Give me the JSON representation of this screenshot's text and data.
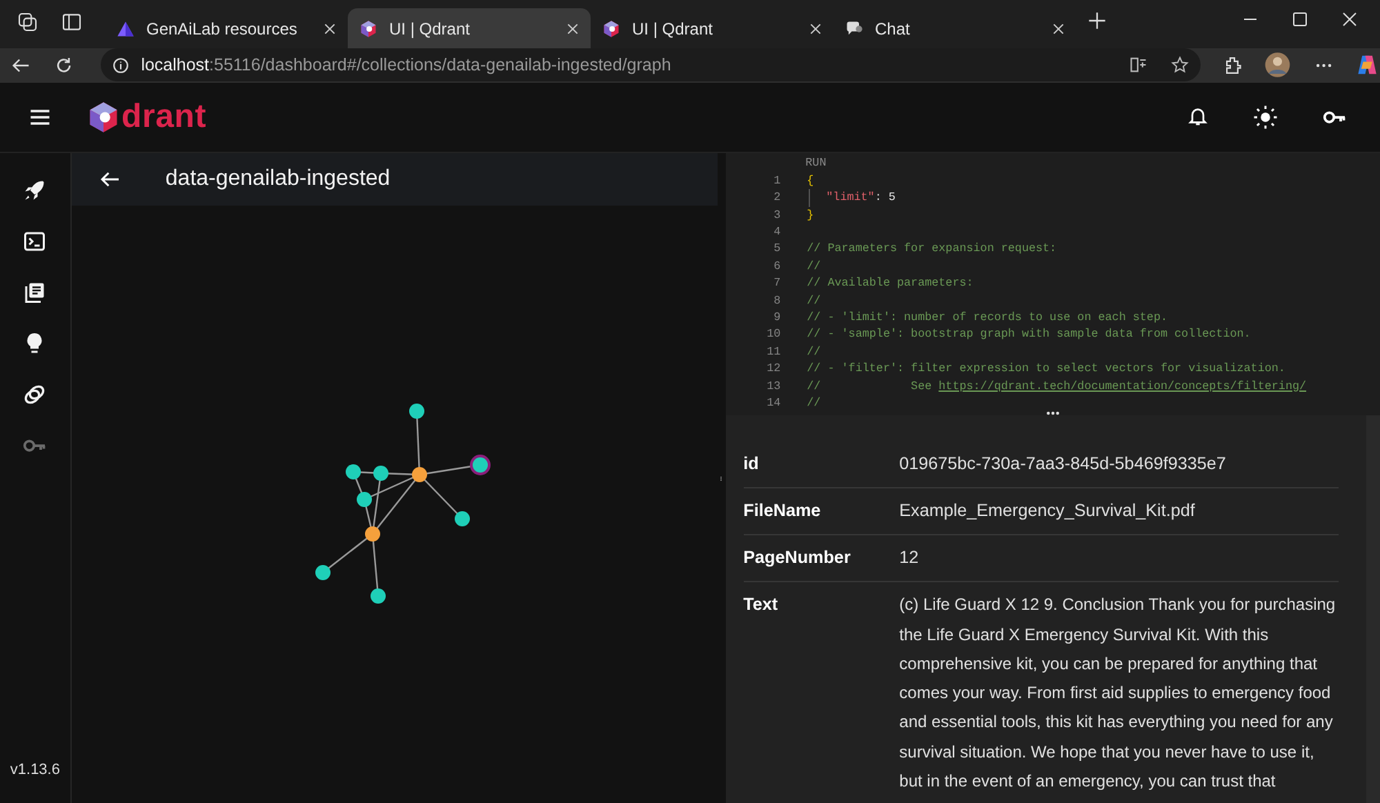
{
  "browser": {
    "tabs": [
      {
        "title": "GenAiLab resources",
        "kind": "triangle",
        "selected": false
      },
      {
        "title": "UI | Qdrant",
        "kind": "qdrant",
        "selected": true
      },
      {
        "title": "UI | Qdrant",
        "kind": "qdrant",
        "selected": false
      },
      {
        "title": "Chat",
        "kind": "chat",
        "selected": false
      }
    ],
    "address": {
      "host": "localhost",
      "path": ":55116/dashboard#/collections/data-genailab-ingested/graph"
    }
  },
  "app": {
    "logo_text": "drant",
    "version": "v1.13.6",
    "sidebar": [
      {
        "kind": "rocket",
        "disabled": false
      },
      {
        "kind": "terminal",
        "disabled": false
      },
      {
        "kind": "collections",
        "disabled": false
      },
      {
        "kind": "bulb",
        "disabled": false
      },
      {
        "kind": "rings",
        "disabled": false
      },
      {
        "kind": "key",
        "disabled": true
      }
    ]
  },
  "collection": {
    "title": "data-genailab-ingested"
  },
  "editor": {
    "run_label": "RUN",
    "lines": [
      {
        "number": "1",
        "tokens": [
          {
            "text": "{",
            "kind": "brace"
          }
        ]
      },
      {
        "number": "2",
        "indented": true,
        "tokens": [
          {
            "text": "\"limit\"",
            "kind": "key"
          },
          {
            "text": ":",
            "kind": "plain"
          },
          {
            "text": " 5",
            "kind": "number"
          }
        ]
      },
      {
        "number": "3",
        "tokens": [
          {
            "text": "}",
            "kind": "brace"
          }
        ]
      },
      {
        "number": "4"
      },
      {
        "number": "5",
        "tokens": [
          {
            "text": "// Parameters for expansion request:",
            "kind": "comment"
          }
        ]
      },
      {
        "number": "6",
        "tokens": [
          {
            "text": "//",
            "kind": "comment"
          }
        ]
      },
      {
        "number": "7",
        "tokens": [
          {
            "text": "// Available parameters:",
            "kind": "comment"
          }
        ]
      },
      {
        "number": "8",
        "tokens": [
          {
            "text": "//",
            "kind": "comment"
          }
        ]
      },
      {
        "number": "9",
        "tokens": [
          {
            "text": "// - 'limit': number of records to use on each step.",
            "kind": "comment"
          }
        ]
      },
      {
        "number": "10",
        "tokens": [
          {
            "text": "// - 'sample': bootstrap graph with sample data from collection.",
            "kind": "comment"
          }
        ]
      },
      {
        "number": "11",
        "tokens": [
          {
            "text": "//",
            "kind": "comment"
          }
        ]
      },
      {
        "number": "12",
        "tokens": [
          {
            "text": "// - 'filter': filter expression to select vectors for visualization.",
            "kind": "comment"
          }
        ]
      },
      {
        "number": "13",
        "tokens": [
          {
            "text": "//             See ",
            "kind": "comment"
          },
          {
            "text": "https://qdrant.tech/documentation/concepts/filtering/",
            "kind": "link"
          }
        ]
      },
      {
        "number": "14",
        "tokens": [
          {
            "text": "//",
            "kind": "comment"
          }
        ]
      }
    ]
  },
  "point": {
    "fields": [
      {
        "key": "id",
        "value": "019675bc-730a-7aa3-845d-5b469f9335e7"
      },
      {
        "key": "FileName",
        "value": "Example_Emergency_Survival_Kit.pdf"
      },
      {
        "key": "PageNumber",
        "value": "12"
      },
      {
        "key": "Text",
        "value": "(c) Life Guard X 12 9. Conclusion Thank you for purchasing the Life Guard X Emergency Survival Kit. With this comprehensive kit, you can be prepared for anything that comes your way. From first aid supplies to emergency food and essential tools, this kit has everything you need for any survival situation. We hope that you never have to use it, but in the event of an emergency, you can trust that"
      }
    ]
  }
}
